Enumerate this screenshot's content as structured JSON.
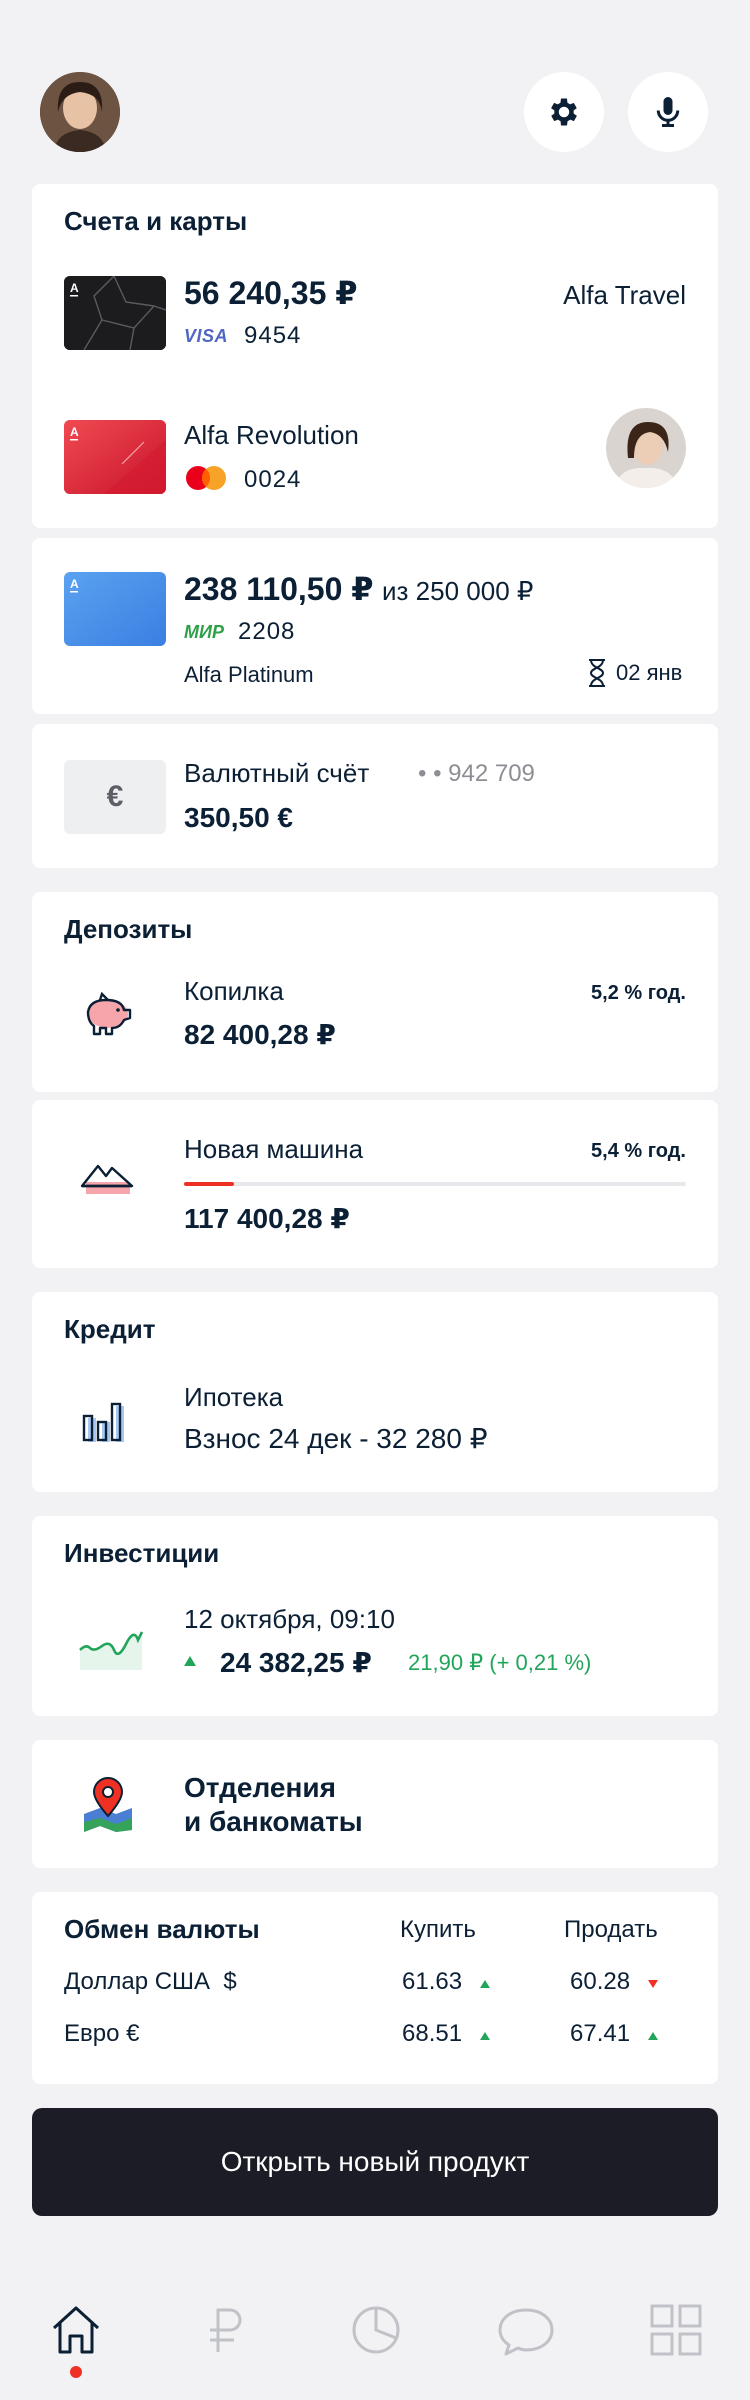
{
  "header": {
    "avatar": "user-avatar",
    "settings_icon": "gear-icon",
    "mic_icon": "microphone-icon"
  },
  "accounts": {
    "title": "Счета и карты",
    "cards": [
      {
        "amount": "56 240,35 ₽",
        "name": "Alfa Travel",
        "network": "VISA",
        "last4": "9454"
      },
      {
        "name": "Alfa Revolution",
        "network": "mastercard",
        "last4": "0024"
      }
    ],
    "credit_card": {
      "amount": "238 110,50 ₽",
      "limit": "из 250 000 ₽",
      "network": "МИР",
      "last4": "2208",
      "name": "Alfa Platinum",
      "due": "02 янв"
    },
    "currency_account": {
      "symbol": "€",
      "name": "Валютный счёт",
      "number": "• • 942 709",
      "amount": "350,50 €"
    }
  },
  "deposits": {
    "title": "Депозиты",
    "items": [
      {
        "name": "Копилка",
        "rate": "5,2 % год.",
        "amount": "82 400,28 ₽",
        "icon": "piggy-bank-icon"
      },
      {
        "name": "Новая машина",
        "rate": "5,4 % год.",
        "amount": "117 400,28 ₽",
        "icon": "mountain-icon",
        "progress": 0.1
      }
    ]
  },
  "credit": {
    "title": "Кредит",
    "name": "Ипотека",
    "detail": "Взнос 24 дек - 32 280 ₽",
    "icon": "bar-chart-icon"
  },
  "investments": {
    "title": "Инвестиции",
    "date": "12 октября, 09:10",
    "amount": "24 382,25 ₽",
    "change": "21,90 ₽ (+ 0,21 %)",
    "icon": "trend-line-icon"
  },
  "branches": {
    "label_line1": "Отделения",
    "label_line2": "и банкоматы",
    "icon": "map-pin-icon"
  },
  "exchange": {
    "title": "Обмен валюты",
    "buy_label": "Купить",
    "sell_label": "Продать",
    "rows": [
      {
        "currency": "Доллар США  $",
        "buy": "61.63",
        "buy_trend": "up",
        "sell": "60.28",
        "sell_trend": "down"
      },
      {
        "currency": "Евро €",
        "buy": "68.51",
        "buy_trend": "up",
        "sell": "67.41",
        "sell_trend": "up"
      }
    ]
  },
  "cta": {
    "label": "Открыть новый продукт"
  },
  "tabbar": {
    "items": [
      {
        "icon": "home-icon",
        "active": true
      },
      {
        "icon": "ruble-icon"
      },
      {
        "icon": "pie-chart-icon"
      },
      {
        "icon": "chat-icon"
      },
      {
        "icon": "grid-icon"
      }
    ]
  },
  "colors": {
    "accent_red": "#ef3124",
    "positive_green": "#22a55b",
    "dark": "#1b1c26",
    "background": "#f2f2f4"
  }
}
